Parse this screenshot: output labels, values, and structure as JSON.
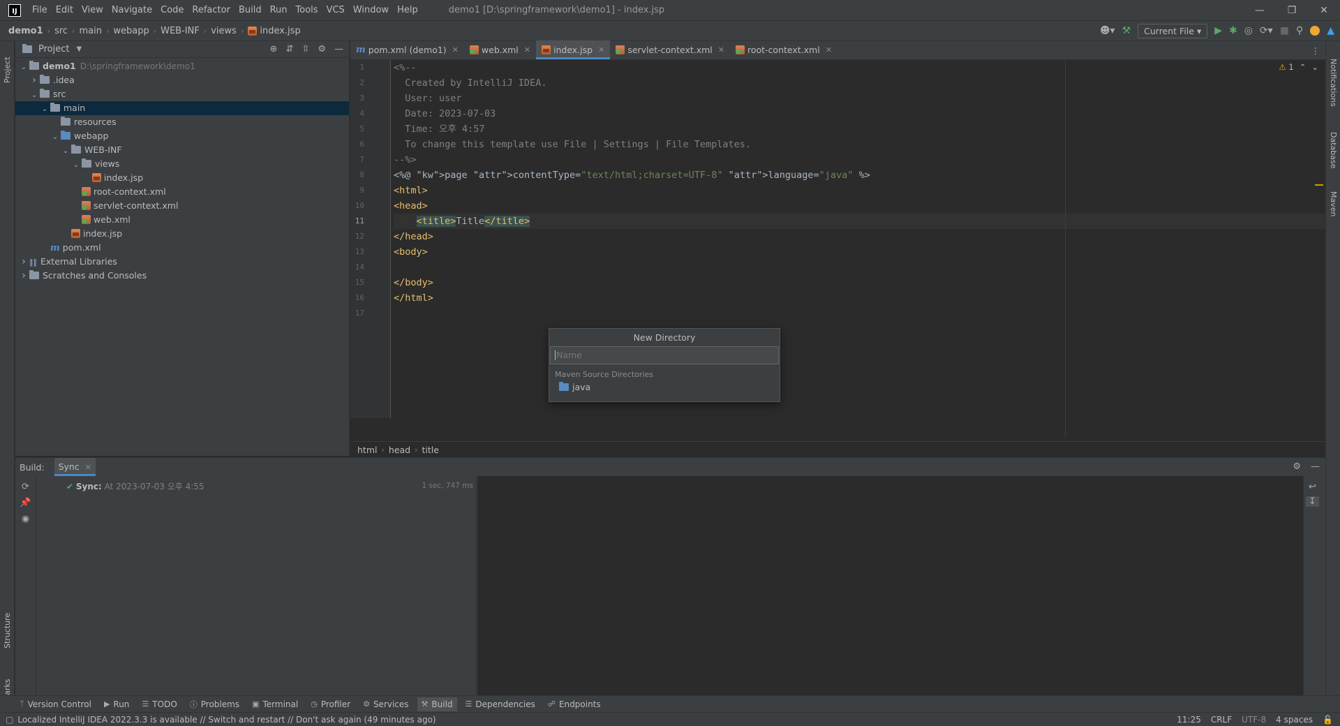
{
  "menubar": {
    "logo": "IJ",
    "items": [
      "File",
      "Edit",
      "View",
      "Navigate",
      "Code",
      "Refactor",
      "Build",
      "Run",
      "Tools",
      "VCS",
      "Window",
      "Help"
    ],
    "window_title": "demo1 [D:\\springframework\\demo1] - index.jsp"
  },
  "breadcrumb": [
    "demo1",
    "src",
    "main",
    "webapp",
    "WEB-INF",
    "views",
    "index.jsp"
  ],
  "run_config": "Current File",
  "left_stripe": {
    "project": "Project",
    "structure": "Structure",
    "bookmarks": "Bookmarks"
  },
  "right_stripe": {
    "notifications": "Notifications",
    "database": "Database",
    "maven": "Maven"
  },
  "project_panel": {
    "title": "Project",
    "tree": [
      {
        "label": "demo1",
        "hint": "D:\\springframework\\demo1",
        "depth": 0,
        "arrow": "v",
        "icon": "folder"
      },
      {
        "label": ".idea",
        "depth": 1,
        "arrow": ">",
        "icon": "folder"
      },
      {
        "label": "src",
        "depth": 1,
        "arrow": "v",
        "icon": "folder"
      },
      {
        "label": "main",
        "depth": 2,
        "arrow": "v",
        "icon": "folder",
        "selected": true
      },
      {
        "label": "resources",
        "depth": 3,
        "arrow": "",
        "icon": "folder-res"
      },
      {
        "label": "webapp",
        "depth": 3,
        "arrow": "v",
        "icon": "folder-web"
      },
      {
        "label": "WEB-INF",
        "depth": 4,
        "arrow": "v",
        "icon": "folder"
      },
      {
        "label": "views",
        "depth": 5,
        "arrow": "v",
        "icon": "folder"
      },
      {
        "label": "index.jsp",
        "depth": 6,
        "arrow": "",
        "icon": "jsp"
      },
      {
        "label": "root-context.xml",
        "depth": 5,
        "arrow": "",
        "icon": "xml"
      },
      {
        "label": "servlet-context.xml",
        "depth": 5,
        "arrow": "",
        "icon": "xml"
      },
      {
        "label": "web.xml",
        "depth": 5,
        "arrow": "",
        "icon": "xml"
      },
      {
        "label": "index.jsp",
        "depth": 4,
        "arrow": "",
        "icon": "jsp"
      },
      {
        "label": "pom.xml",
        "depth": 2,
        "arrow": "",
        "icon": "maven"
      },
      {
        "label": "External Libraries",
        "depth": 0,
        "arrow": ">",
        "icon": "lib"
      },
      {
        "label": "Scratches and Consoles",
        "depth": 0,
        "arrow": ">",
        "icon": "scratch"
      }
    ]
  },
  "editor": {
    "tabs": [
      {
        "label": "pom.xml (demo1)",
        "icon": "maven"
      },
      {
        "label": "web.xml",
        "icon": "xml"
      },
      {
        "label": "index.jsp",
        "icon": "jsp",
        "active": true
      },
      {
        "label": "servlet-context.xml",
        "icon": "xml"
      },
      {
        "label": "root-context.xml",
        "icon": "xml"
      }
    ],
    "warnings": "1",
    "current_line": 11,
    "lines": [
      "<%--",
      "  Created by IntelliJ IDEA.",
      "  User: user",
      "  Date: 2023-07-03",
      "  Time: 오후 4:57",
      "  To change this template use File | Settings | File Templates.",
      "--%>",
      "<%@ page contentType=\"text/html;charset=UTF-8\" language=\"java\" %>",
      "<html>",
      "<head>",
      "    <title>Title</title>",
      "</head>",
      "<body>",
      "",
      "</body>",
      "</html>",
      ""
    ],
    "footer_breadcrumb": [
      "html",
      "head",
      "title"
    ]
  },
  "new_directory": {
    "title": "New Directory",
    "placeholder": "Name",
    "section": "Maven Source Directories",
    "option": "java"
  },
  "build_panel": {
    "label": "Build:",
    "tab": "Sync",
    "sync_label": "Sync:",
    "sync_time": "At 2023-07-03 오후 4:55",
    "duration": "1 sec, 747 ms"
  },
  "tool_windows": [
    "Version Control",
    "Run",
    "TODO",
    "Problems",
    "Terminal",
    "Profiler",
    "Services",
    "Build",
    "Dependencies",
    "Endpoints"
  ],
  "status": {
    "message": "Localized IntelliJ IDEA 2022.3.3 is available // Switch and restart // Don't ask again (49 minutes ago)",
    "position": "11:25",
    "line_sep": "CRLF",
    "encoding": "UTF-8",
    "indent": "4 spaces"
  }
}
